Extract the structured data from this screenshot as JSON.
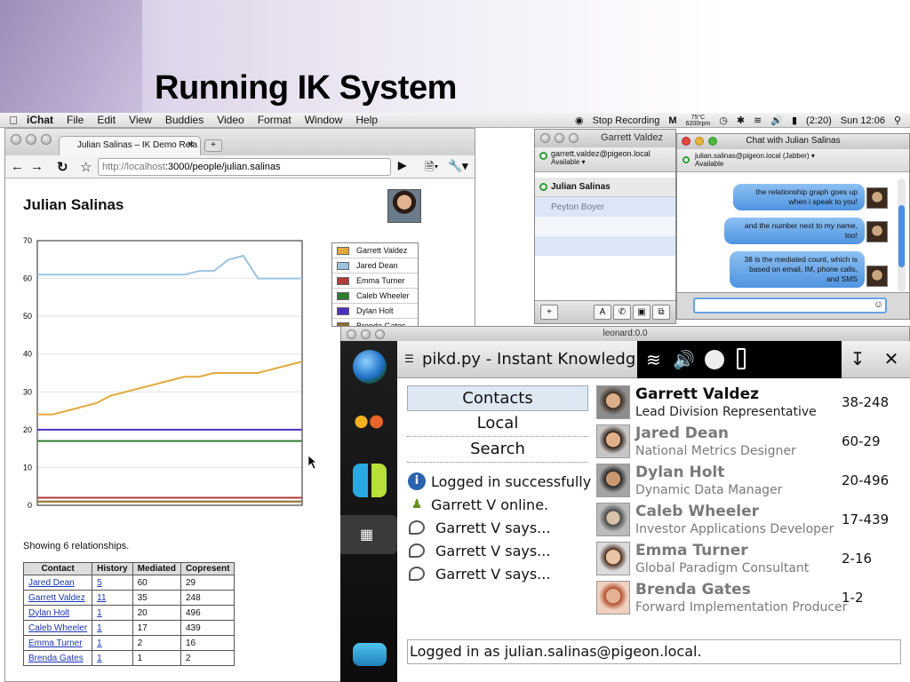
{
  "slide": {
    "title": "Running IK System"
  },
  "menubar": {
    "app": "iChat",
    "items": [
      "File",
      "Edit",
      "View",
      "Buddies",
      "Video",
      "Format",
      "Window",
      "Help"
    ],
    "stop_recording": "Stop Recording",
    "temp_top": "75°C",
    "temp_bottom": "6200rpm",
    "battery": "(2:20)",
    "clock": "Sun 12:06"
  },
  "browser": {
    "tab_title": "Julian Salinas – IK Demo Rela",
    "url_host": "http://localhost",
    "url_path": ":3000/people/julian.salinas",
    "person_name": "Julian Salinas",
    "showing": "Showing 6 relationships.",
    "table": {
      "headers": [
        "Contact",
        "History",
        "Mediated",
        "Copresent"
      ],
      "rows": [
        [
          "Jared Dean",
          "5",
          "60",
          "29"
        ],
        [
          "Garrett Valdez",
          "11",
          "35",
          "248"
        ],
        [
          "Dylan Holt",
          "1",
          "20",
          "496"
        ],
        [
          "Caleb Wheeler",
          "1",
          "17",
          "439"
        ],
        [
          "Emma Turner",
          "1",
          "2",
          "16"
        ],
        [
          "Brenda Gates",
          "1",
          "1",
          "2"
        ]
      ]
    }
  },
  "chart_data": {
    "type": "line",
    "ylim": [
      0,
      70
    ],
    "yticks": [
      "70",
      "60",
      "50",
      "40",
      "30",
      "20",
      "10",
      "0"
    ],
    "series": [
      {
        "name": "Garrett Valdez",
        "color": "#e3a93a",
        "values": [
          24,
          24,
          25,
          26,
          27,
          29,
          30,
          31,
          32,
          33,
          34,
          34,
          35,
          35,
          35,
          35,
          36,
          37,
          38
        ]
      },
      {
        "name": "Jared Dean",
        "color": "#9cc3e0",
        "values": [
          61,
          61,
          61,
          61,
          61,
          61,
          61,
          61,
          61,
          61,
          61,
          62,
          62,
          65,
          66,
          60,
          60,
          60,
          60
        ]
      },
      {
        "name": "Emma Turner",
        "color": "#b23a3a",
        "values": [
          2,
          2,
          2,
          2,
          2,
          2,
          2,
          2,
          2,
          2,
          2,
          2,
          2,
          2,
          2,
          2,
          2,
          2,
          2
        ]
      },
      {
        "name": "Caleb Wheeler",
        "color": "#2e7d32",
        "values": [
          17,
          17,
          17,
          17,
          17,
          17,
          17,
          17,
          17,
          17,
          17,
          17,
          17,
          17,
          17,
          17,
          17,
          17,
          17
        ]
      },
      {
        "name": "Dylan Holt",
        "color": "#4b2fc1",
        "values": [
          20,
          20,
          20,
          20,
          20,
          20,
          20,
          20,
          20,
          20,
          20,
          20,
          20,
          20,
          20,
          20,
          20,
          20,
          20
        ]
      },
      {
        "name": "Brenda Gates",
        "color": "#8a6a2a",
        "values": [
          1,
          1,
          1,
          1,
          1,
          1,
          1,
          1,
          1,
          1,
          1,
          1,
          1,
          1,
          1,
          1,
          1,
          1,
          1
        ]
      }
    ]
  },
  "legend_labels": [
    "Garrett Valdez",
    "Jared Dean",
    "Emma Turner",
    "Caleb Wheeler",
    "Dylan Holt",
    "Brenda Gates"
  ],
  "buddy_list": {
    "title": "Garrett Valdez",
    "account": "garrett.valdez@pigeon.local",
    "status": "Available",
    "online": "Julian Salinas",
    "offline": "Peyton Boyer",
    "btn_add": "+",
    "btn_a": "A"
  },
  "chat": {
    "title": "Chat with Julian Salinas",
    "account": "julian.salinas@pigeon.local (Jabber)",
    "status": "Available",
    "messages": [
      "the relationship graph goes up when i speak to you!",
      "and the number next to my name, too!",
      "38 is the mediated count, which is based on email, IM, phone calls, and SMS"
    ]
  },
  "leonard": {
    "title": "leonard:0.0",
    "app_title": "pikd.py - Instant Knowledg...",
    "tabs": [
      "Contacts",
      "Local",
      "Search"
    ],
    "log": [
      "Logged in successfully",
      "Garrett V online.",
      "Garrett V says...",
      "Garrett V says...",
      "Garrett V says..."
    ],
    "contacts": [
      {
        "name": "Garrett Valdez",
        "role": "Lead Division Representative",
        "score": "38-248"
      },
      {
        "name": "Jared Dean",
        "role": "National Metrics Designer",
        "score": "60-29"
      },
      {
        "name": "Dylan Holt",
        "role": "Dynamic Data Manager",
        "score": "20-496"
      },
      {
        "name": "Caleb Wheeler",
        "role": "Investor Applications Developer",
        "score": "17-439"
      },
      {
        "name": "Emma Turner",
        "role": "Global Paradigm Consultant",
        "score": "2-16"
      },
      {
        "name": "Brenda Gates",
        "role": "Forward Implementation Producer",
        "score": "1-2"
      }
    ],
    "status_line": "Logged in as julian.salinas@pigeon.local."
  }
}
